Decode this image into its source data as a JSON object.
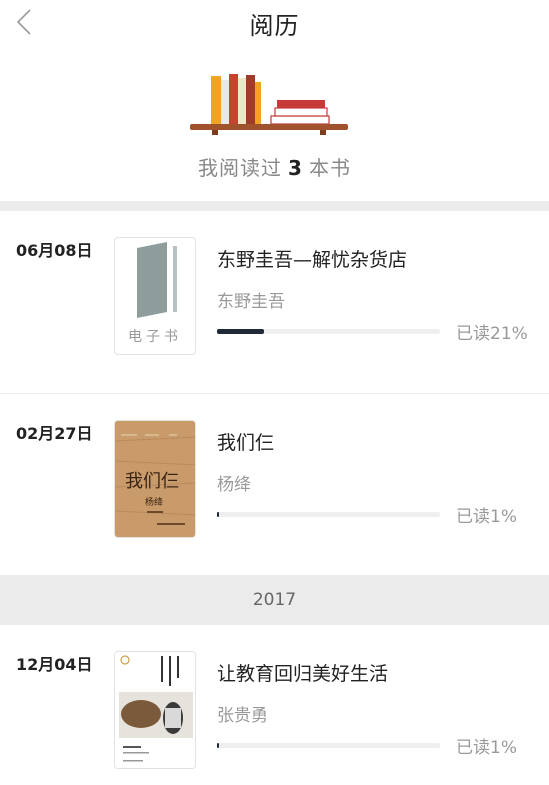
{
  "header": {
    "title": "阅历"
  },
  "summary": {
    "prefix": "我阅读过",
    "count": "3",
    "suffix": "本书"
  },
  "books": [
    {
      "date": "06月08日",
      "title": "东野圭吾—解忧杂货店",
      "author": "东野圭吾",
      "progress": 0.21,
      "progress_label": "已读21%",
      "cover_type": "ebook",
      "cover_label": "电子书"
    },
    {
      "date": "02月27日",
      "title": "我们仨",
      "author": "杨绛",
      "progress": 0.01,
      "progress_label": "已读1%",
      "cover_type": "kraft",
      "cover_title": "我们仨",
      "cover_author": "杨绛"
    },
    {
      "date": "12月04日",
      "title": "让教育回归美好生活",
      "author": "张贵勇",
      "progress": 0.01,
      "progress_label": "已读1%",
      "cover_type": "photo"
    }
  ],
  "year_divider": "2017",
  "colors": {
    "progress_fill": "#1f2a36",
    "progress_track": "#efefef",
    "separator": "#ececec"
  }
}
